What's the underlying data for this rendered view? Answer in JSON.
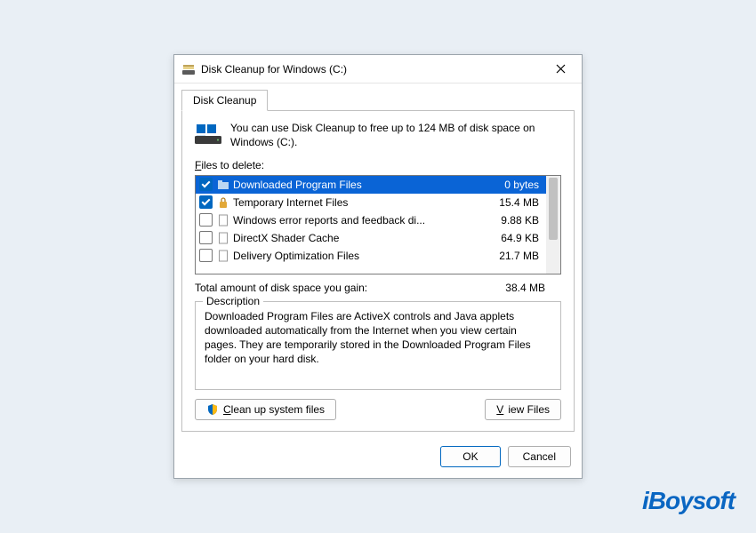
{
  "titlebar": {
    "title": "Disk Cleanup for Windows (C:)"
  },
  "tab": {
    "label": "Disk Cleanup"
  },
  "info": {
    "text": "You can use Disk Cleanup to free up to 124 MB of disk space on Windows (C:)."
  },
  "list": {
    "label": "Files to delete:",
    "items": [
      {
        "name": "Downloaded Program Files",
        "size": "0 bytes",
        "checked": true,
        "selected": true,
        "icon": "folder"
      },
      {
        "name": "Temporary Internet Files",
        "size": "15.4 MB",
        "checked": true,
        "selected": false,
        "icon": "lock"
      },
      {
        "name": "Windows error reports and feedback di...",
        "size": "9.88 KB",
        "checked": false,
        "selected": false,
        "icon": "file"
      },
      {
        "name": "DirectX Shader Cache",
        "size": "64.9 KB",
        "checked": false,
        "selected": false,
        "icon": "file"
      },
      {
        "name": "Delivery Optimization Files",
        "size": "21.7 MB",
        "checked": false,
        "selected": false,
        "icon": "file"
      }
    ]
  },
  "total": {
    "label": "Total amount of disk space you gain:",
    "value": "38.4 MB"
  },
  "description": {
    "legend": "Description",
    "text": "Downloaded Program Files are ActiveX controls and Java applets downloaded automatically from the Internet when you view certain pages. They are temporarily stored in the Downloaded Program Files folder on your hard disk."
  },
  "buttons": {
    "cleanup_system": "Clean up system files",
    "view_files": "View Files",
    "ok": "OK",
    "cancel": "Cancel"
  },
  "watermark": "iBoysoft"
}
